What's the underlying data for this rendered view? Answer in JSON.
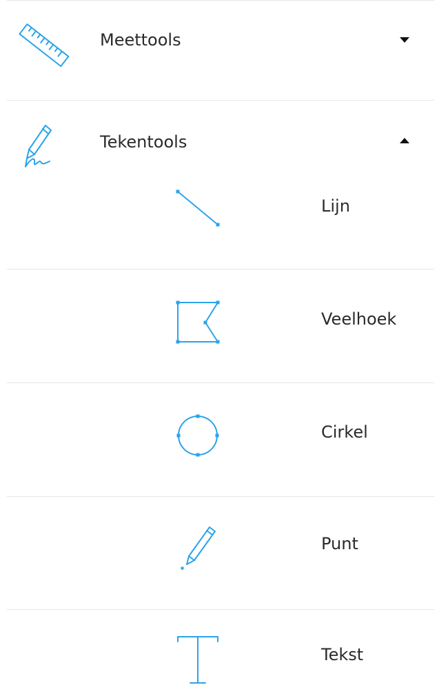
{
  "sections": [
    {
      "label": "Meettools",
      "icon": "ruler-icon",
      "expanded": false
    },
    {
      "label": "Tekentools",
      "icon": "pen-signature-icon",
      "expanded": true
    }
  ],
  "tools": [
    {
      "label": "Lijn",
      "icon": "line-icon"
    },
    {
      "label": "Veelhoek",
      "icon": "polygon-icon"
    },
    {
      "label": "Cirkel",
      "icon": "circle-icon"
    },
    {
      "label": "Punt",
      "icon": "point-pencil-icon"
    },
    {
      "label": "Tekst",
      "icon": "text-icon"
    }
  ],
  "colors": {
    "accent": "#2aa3ea",
    "divider": "#e6e6e6",
    "text": "#2a2a2a"
  }
}
